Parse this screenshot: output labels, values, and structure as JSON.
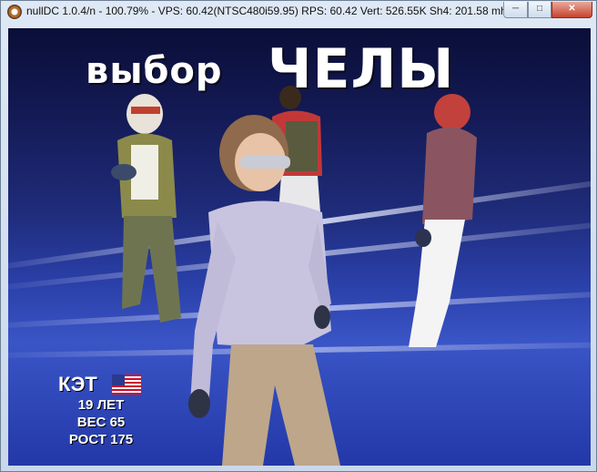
{
  "window": {
    "title": "nullDC 1.0.4/n - 100.79% - VPS: 60.42(NTSC480i59.95) RPS: 60.42 Vert: 526.55K Sh4: 201.58 mhz",
    "minimize_icon": "minimize-icon",
    "maximize_icon": "maximize-icon",
    "close_icon": "close-icon",
    "minimize_glyph": "─",
    "maximize_glyph": "□",
    "close_glyph": "✕"
  },
  "game": {
    "header_word1": "выбор",
    "header_word2": "ЧЕЛЫ",
    "character": {
      "name": "КЭТ",
      "flag": "us-flag-icon",
      "age": "19 ЛЕТ",
      "weight": "ВЕС 65",
      "height": "РОСТ 175"
    },
    "colors": {
      "background_dark": "#0a0e38",
      "background_mid": "#2a3fa8",
      "text": "#ffffff"
    }
  }
}
